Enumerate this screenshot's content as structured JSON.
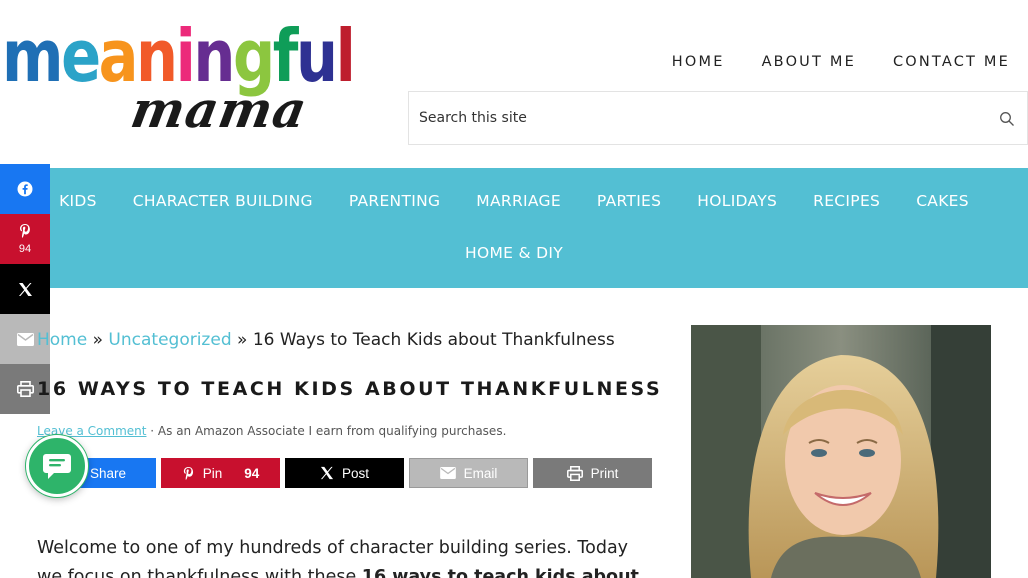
{
  "logo": {
    "letters": [
      "m",
      "e",
      "a",
      "n",
      "i",
      "n",
      "g",
      "f",
      "u",
      "l"
    ],
    "letter_colors": [
      "#1f6fb5",
      "#2ba3c8",
      "#f7941d",
      "#f15a29",
      "#ec2a7a",
      "#662d91",
      "#8cc63f",
      "#0f9d58",
      "#2e3192",
      "#be1e2d"
    ],
    "subtitle": "mama"
  },
  "top_nav": [
    "HOME",
    "ABOUT ME",
    "CONTACT ME"
  ],
  "search": {
    "placeholder": "Search this site",
    "icon": "search-icon"
  },
  "main_nav": {
    "row1": [
      "KIDS",
      "CHARACTER BUILDING",
      "PARENTING",
      "MARRIAGE",
      "PARTIES",
      "HOLIDAYS",
      "RECIPES",
      "CAKES"
    ],
    "row2": [
      "HOME & DIY"
    ],
    "background": "#53bfd3"
  },
  "side_share": {
    "pin_count": "94"
  },
  "breadcrumb": {
    "home": "Home",
    "sep1": "»",
    "category": "Uncategorized",
    "sep2": "»",
    "current": "16 Ways to Teach Kids about Thankfulness"
  },
  "post": {
    "title": "16 WAYS TO TEACH KIDS ABOUT THANKFULNESS",
    "comment_link": "Leave a Comment",
    "meta_text": " · As an Amazon Associate I earn from qualifying purchases.",
    "intro_1": "Welcome to one of my hundreds of character building series. Today we focus on thankfulness with these ",
    "intro_bold": "16 ways to teach kids about"
  },
  "share_buttons": {
    "facebook": "Share",
    "pinterest": "Pin",
    "pinterest_count": "94",
    "x": "Post",
    "email": "Email",
    "print": "Print"
  },
  "colors": {
    "accent": "#53bfd3",
    "facebook": "#1877f2",
    "pinterest": "#c8102e",
    "chat": "#2eb46a"
  }
}
